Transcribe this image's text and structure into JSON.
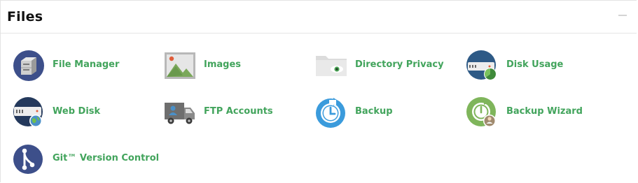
{
  "section": {
    "title": "Files",
    "collapse_icon": "minus-icon"
  },
  "items": [
    {
      "label": "File Manager",
      "icon": "file-manager-icon"
    },
    {
      "label": "Images",
      "icon": "images-icon"
    },
    {
      "label": "Directory Privacy",
      "icon": "directory-privacy-icon"
    },
    {
      "label": "Disk Usage",
      "icon": "disk-usage-icon"
    },
    {
      "label": "Web Disk",
      "icon": "web-disk-icon"
    },
    {
      "label": "FTP Accounts",
      "icon": "ftp-accounts-icon"
    },
    {
      "label": "Backup",
      "icon": "backup-icon"
    },
    {
      "label": "Backup Wizard",
      "icon": "backup-wizard-icon"
    },
    {
      "label": "Git™ Version Control",
      "icon": "git-version-control-icon"
    }
  ],
  "colors": {
    "link": "#42a45c",
    "navy": "#3d4f8a",
    "blue": "#3b9bdc",
    "green": "#7fb55b"
  }
}
